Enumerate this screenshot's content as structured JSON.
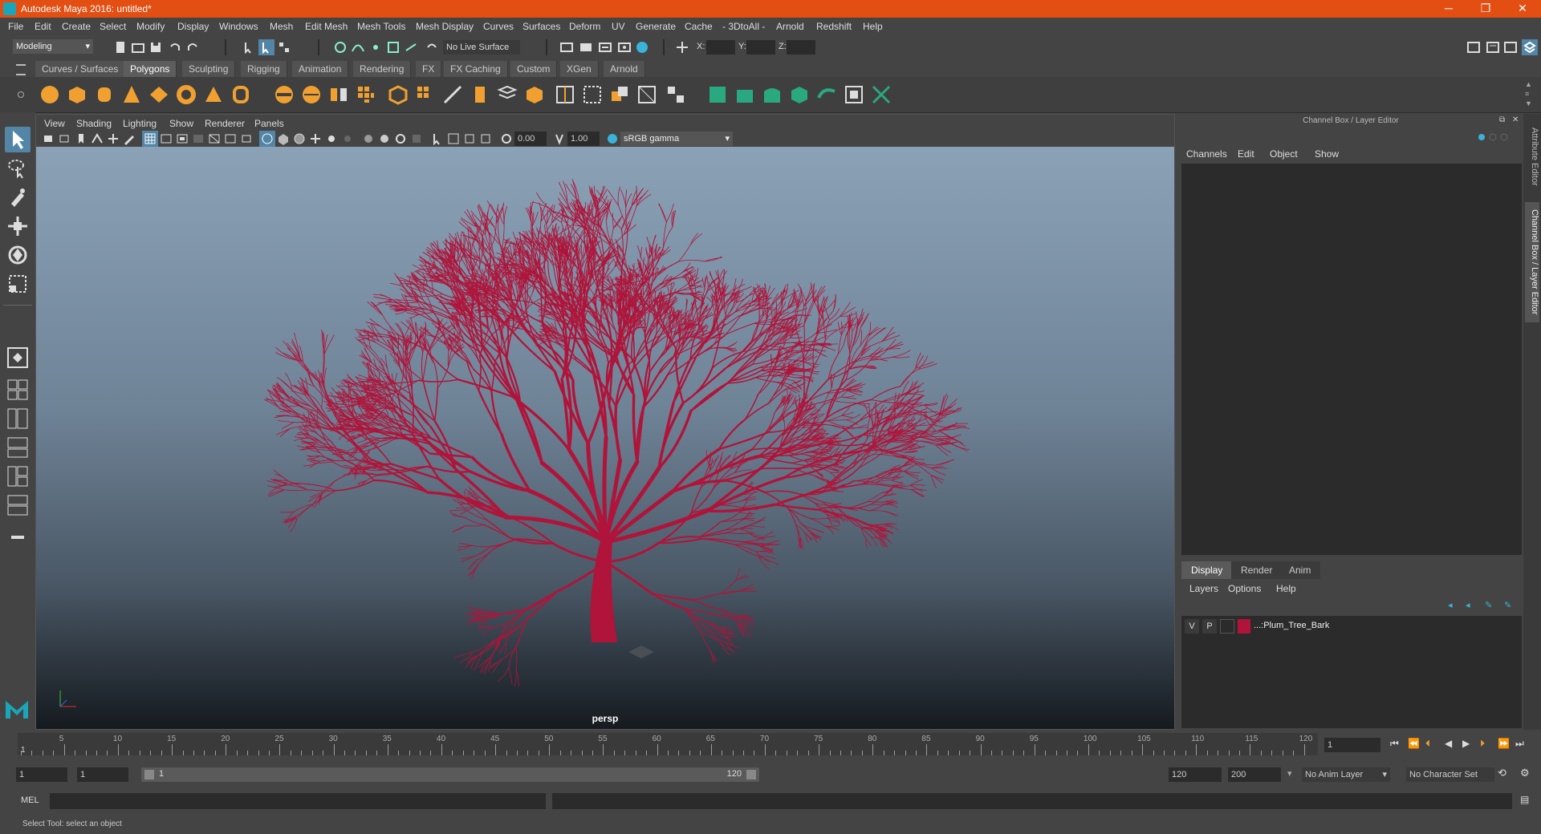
{
  "window": {
    "title": "Autodesk Maya 2016: untitled*",
    "minimize": "─",
    "maximize": "❐",
    "close": "✕"
  },
  "menu": [
    "File",
    "Edit",
    "Create",
    "Select",
    "Modify",
    "Display",
    "Windows",
    "Mesh",
    "Edit Mesh",
    "Mesh Tools",
    "Mesh Display",
    "Curves",
    "Surfaces",
    "Deform",
    "UV",
    "Generate",
    "Cache",
    "- 3DtoAll -",
    "Arnold",
    "Redshift",
    "Help"
  ],
  "statusline": {
    "mode": "Modeling",
    "live_surface": "No Live Surface",
    "x_label": "X:",
    "y_label": "Y:",
    "z_label": "Z:"
  },
  "shelf_tabs": [
    "Curves / Surfaces",
    "Polygons",
    "Sculpting",
    "Rigging",
    "Animation",
    "Rendering",
    "FX",
    "FX Caching",
    "Custom",
    "XGen",
    "Arnold"
  ],
  "shelf_active": "Polygons",
  "viewport": {
    "menu": [
      "View",
      "Shading",
      "Lighting",
      "Show",
      "Renderer",
      "Panels"
    ],
    "exposure": "0.00",
    "gamma": "1.00",
    "color_space": "sRGB gamma",
    "camera_label": "persp"
  },
  "channel_box": {
    "title": "Channel Box / Layer Editor",
    "menu": [
      "Channels",
      "Edit",
      "Object",
      "Show"
    ]
  },
  "layer_editor": {
    "tabs": [
      "Display",
      "Render",
      "Anim"
    ],
    "menu": [
      "Layers",
      "Options",
      "Help"
    ],
    "layer": {
      "v": "V",
      "p": "P",
      "name": "...:Plum_Tree_Bark",
      "color": "#b0143a"
    }
  },
  "side_tabs": [
    "Attribute Editor",
    "Channel Box / Layer Editor"
  ],
  "timeline": {
    "ticks": [
      "5",
      "10",
      "15",
      "20",
      "25",
      "30",
      "35",
      "40",
      "45",
      "50",
      "55",
      "60",
      "65",
      "70",
      "75",
      "80",
      "85",
      "90",
      "95",
      "100",
      "105",
      "110",
      "115",
      "120"
    ],
    "start_marker": "1",
    "current_frame": "1"
  },
  "range": {
    "start": "1",
    "playback_start": "1",
    "bar_start": "1",
    "bar_end": "120",
    "playback_end": "120",
    "end": "200",
    "anim_layer": "No Anim Layer",
    "character_set": "No Character Set"
  },
  "command": {
    "label": "MEL"
  },
  "help_line": "Select Tool: select an object",
  "colors": {
    "title_bar": "#e34e12",
    "tree": "#b0143a",
    "active_tool": "#5285a6"
  }
}
